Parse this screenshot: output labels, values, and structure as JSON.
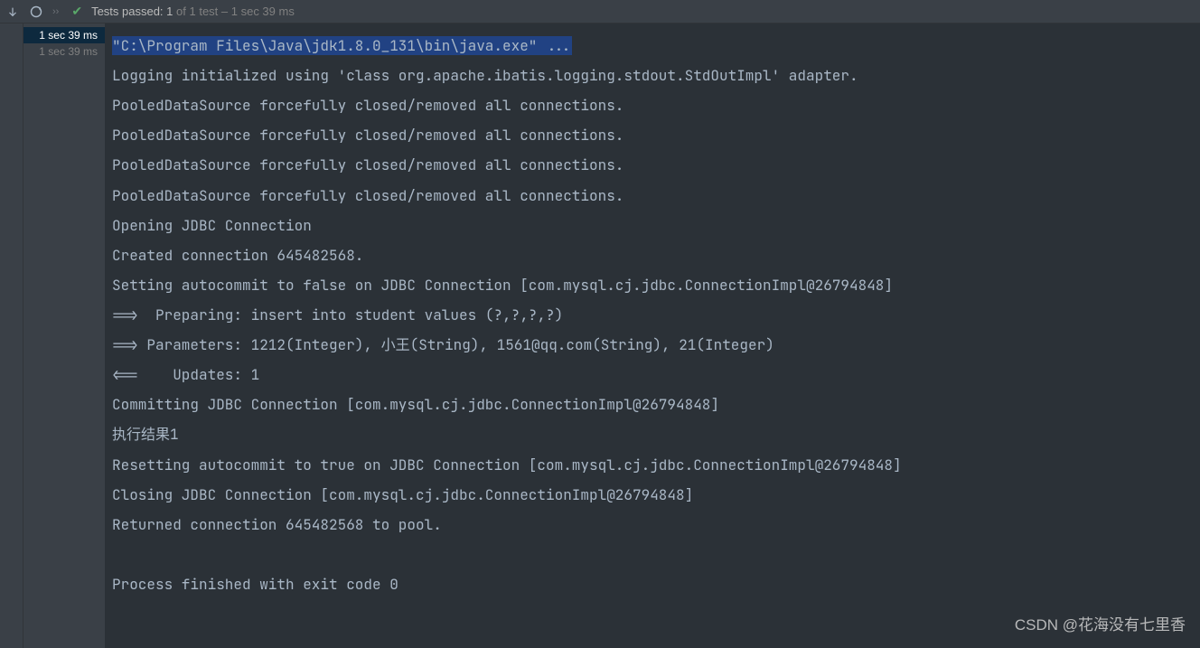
{
  "toolbar": {
    "status_prefix": "Tests passed:",
    "status_count": " 1 ",
    "status_of": "of 1 test",
    "status_dash": " – ",
    "status_time": "1 sec 39 ms"
  },
  "tree": {
    "items": [
      {
        "time": "1 sec 39 ms",
        "selected": true
      },
      {
        "time": "1 sec 39 ms",
        "selected": false
      }
    ]
  },
  "console": {
    "cmd": "\"C:\\Program Files\\Java\\jdk1.8.0_131\\bin\\java.exe\" ...",
    "lines": [
      "Logging initialized using 'class org.apache.ibatis.logging.stdout.StdOutImpl' adapter.",
      "PooledDataSource forcefully closed/removed all connections.",
      "PooledDataSource forcefully closed/removed all connections.",
      "PooledDataSource forcefully closed/removed all connections.",
      "PooledDataSource forcefully closed/removed all connections.",
      "Opening JDBC Connection",
      "Created connection 645482568.",
      "Setting autocommit to false on JDBC Connection [com.mysql.cj.jdbc.ConnectionImpl@26794848]",
      "==>  Preparing: insert into student values (?,?,?,?)",
      "==> Parameters: 1212(Integer), 小王(String), 1561@qq.com(String), 21(Integer)",
      "<==    Updates: 1",
      "Committing JDBC Connection [com.mysql.cj.jdbc.ConnectionImpl@26794848]",
      "执行结果1",
      "Resetting autocommit to true on JDBC Connection [com.mysql.cj.jdbc.ConnectionImpl@26794848]",
      "Closing JDBC Connection [com.mysql.cj.jdbc.ConnectionImpl@26794848]",
      "Returned connection 645482568 to pool.",
      "",
      "Process finished with exit code 0"
    ]
  },
  "watermark": "CSDN @花海没有七里香"
}
